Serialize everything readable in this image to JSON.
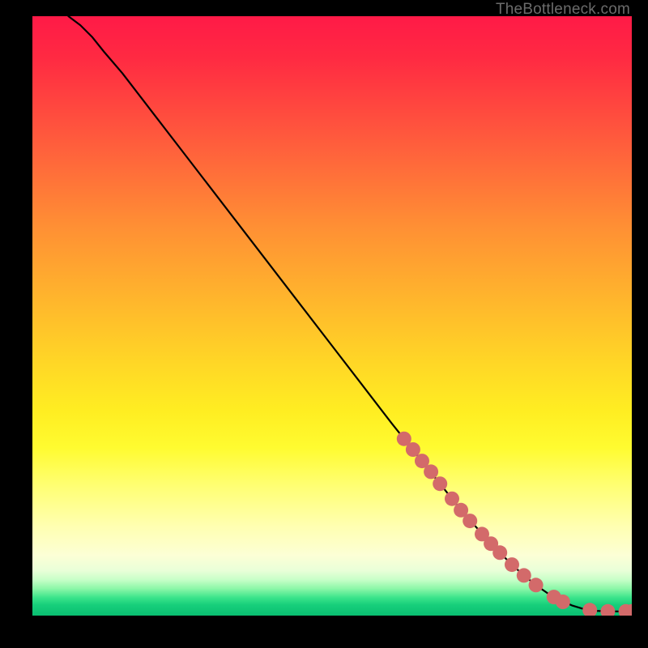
{
  "watermark": "TheBottleneck.com",
  "chart_data": {
    "type": "line",
    "title": "",
    "xlabel": "",
    "ylabel": "",
    "xlim": [
      0,
      100
    ],
    "ylim": [
      0,
      100
    ],
    "series": [
      {
        "name": "curve",
        "x": [
          6,
          8,
          10,
          12,
          15,
          20,
          25,
          30,
          35,
          40,
          45,
          50,
          55,
          60,
          62,
          64,
          66,
          68,
          70,
          72,
          74,
          76,
          78,
          80,
          82,
          84,
          86,
          88,
          90,
          92,
          94,
          96,
          98,
          100
        ],
        "y": [
          100,
          98.5,
          96.5,
          94,
          90.5,
          84,
          77.5,
          71,
          64.5,
          58,
          51.5,
          45,
          38.5,
          32,
          29.5,
          27,
          24.5,
          22,
          19.5,
          17,
          14.8,
          12.6,
          10.5,
          8.5,
          6.7,
          5.1,
          3.7,
          2.6,
          1.7,
          1.1,
          0.8,
          0.7,
          0.7,
          0.7
        ]
      }
    ],
    "markers": {
      "name": "highlighted-points",
      "color": "#d36a6a",
      "radius": 9,
      "points": [
        {
          "x": 62,
          "y": 29.5
        },
        {
          "x": 63.5,
          "y": 27.7
        },
        {
          "x": 65,
          "y": 25.8
        },
        {
          "x": 66.5,
          "y": 24.0
        },
        {
          "x": 68,
          "y": 22.0
        },
        {
          "x": 70,
          "y": 19.5
        },
        {
          "x": 71.5,
          "y": 17.6
        },
        {
          "x": 73,
          "y": 15.8
        },
        {
          "x": 75,
          "y": 13.6
        },
        {
          "x": 76.5,
          "y": 12.0
        },
        {
          "x": 78,
          "y": 10.5
        },
        {
          "x": 80,
          "y": 8.5
        },
        {
          "x": 82,
          "y": 6.7
        },
        {
          "x": 84,
          "y": 5.1
        },
        {
          "x": 87,
          "y": 3.1
        },
        {
          "x": 88.5,
          "y": 2.3
        },
        {
          "x": 93,
          "y": 0.9
        },
        {
          "x": 96,
          "y": 0.7
        },
        {
          "x": 99,
          "y": 0.7
        },
        {
          "x": 100,
          "y": 0.7
        }
      ]
    }
  }
}
